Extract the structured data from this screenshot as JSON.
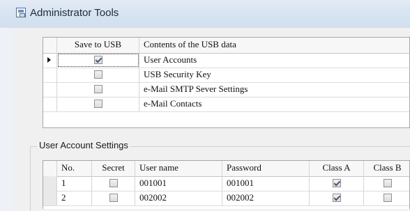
{
  "window": {
    "title": "Administrator Tools"
  },
  "usb_table": {
    "columns": [
      "Save to USB",
      "Contents of the USB data"
    ],
    "rows": [
      {
        "checked": true,
        "label": "User Accounts",
        "selected": true
      },
      {
        "checked": false,
        "label": "USB Security Key"
      },
      {
        "checked": false,
        "label": "e-Mail SMTP Sever Settings"
      },
      {
        "checked": false,
        "label": "e-Mail Contacts"
      }
    ]
  },
  "user_account_settings": {
    "group_label": "User Account Settings",
    "columns": [
      "No.",
      "Secret",
      "User name",
      "Password",
      "Class A",
      "Class B"
    ],
    "rows": [
      {
        "no": "1",
        "secret": false,
        "user": "001001",
        "password": "001001",
        "class_a": true,
        "class_b": false
      },
      {
        "no": "2",
        "secret": false,
        "user": "002002",
        "password": "002002",
        "class_a": true,
        "class_b": false
      }
    ]
  }
}
